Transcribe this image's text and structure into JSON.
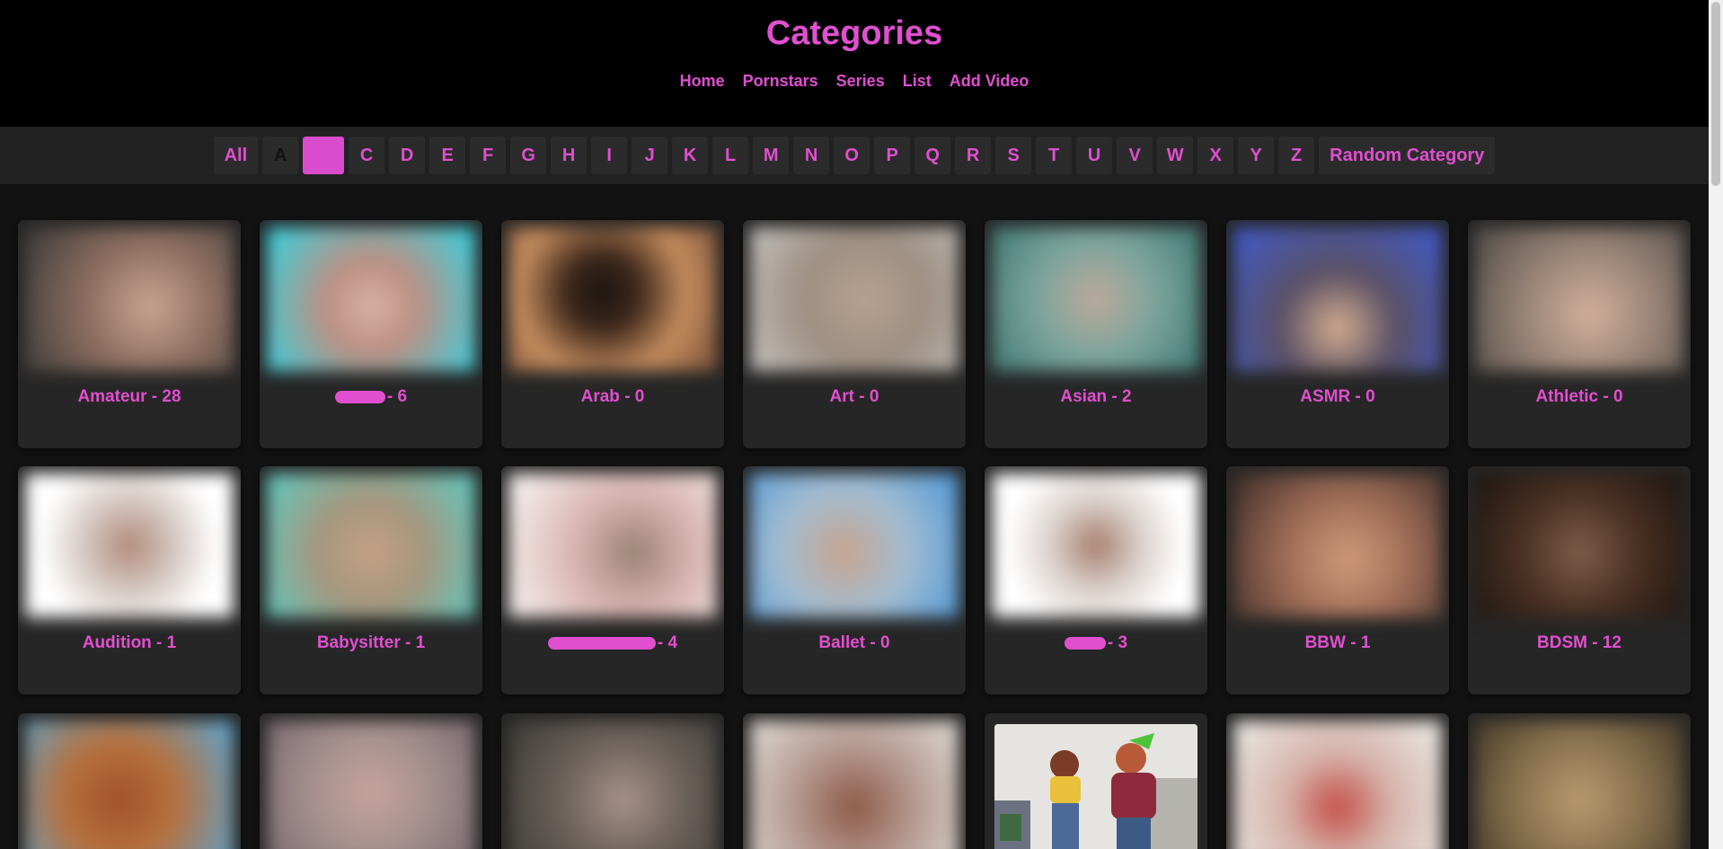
{
  "header": {
    "title": "Categories",
    "nav": [
      "Home",
      "Pornstars",
      "Series",
      "List",
      "Add Video"
    ]
  },
  "letters": [
    "All",
    "A",
    "B",
    "C",
    "D",
    "E",
    "F",
    "G",
    "H",
    "I",
    "J",
    "K",
    "L",
    "M",
    "N",
    "O",
    "P",
    "Q",
    "R",
    "S",
    "T",
    "U",
    "V",
    "W",
    "X",
    "Y",
    "Z",
    "Random Category"
  ],
  "active_letter": "B",
  "accent_color": "#e04fcf",
  "categories": [
    {
      "name": "Amateur",
      "count": "28",
      "label": "Amateur - 28"
    },
    {
      "name": "",
      "count": "6",
      "label": "- 6",
      "redacted": true
    },
    {
      "name": "Arab",
      "count": "0",
      "label": "Arab - 0"
    },
    {
      "name": "Art",
      "count": "0",
      "label": "Art - 0"
    },
    {
      "name": "Asian",
      "count": "2",
      "label": "Asian - 2"
    },
    {
      "name": "ASMR",
      "count": "0",
      "label": "ASMR - 0"
    },
    {
      "name": "Athletic",
      "count": "0",
      "label": "Athletic - 0"
    },
    {
      "name": "Audition",
      "count": "1",
      "label": "Audition - 1"
    },
    {
      "name": "Babysitter",
      "count": "1",
      "label": "Babysitter - 1"
    },
    {
      "name": "",
      "count": "4",
      "label": "- 4",
      "redacted": true
    },
    {
      "name": "Ballet",
      "count": "0",
      "label": "Ballet - 0"
    },
    {
      "name": "",
      "count": "3",
      "label": "- 3",
      "redacted": true
    },
    {
      "name": "BBW",
      "count": "1",
      "label": "BBW - 1"
    },
    {
      "name": "BDSM",
      "count": "12",
      "label": "BDSM - 12"
    }
  ]
}
